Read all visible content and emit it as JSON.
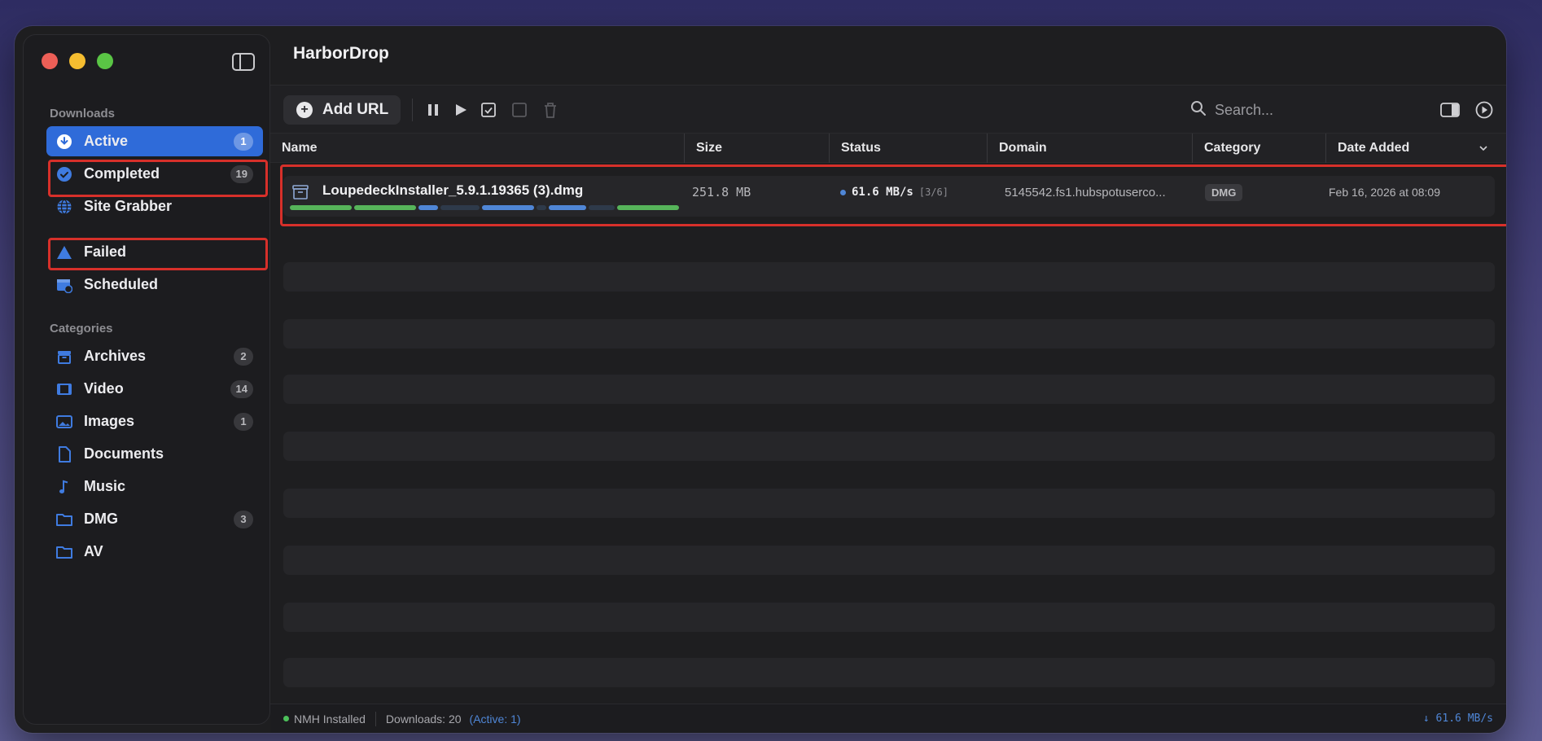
{
  "app": {
    "title": "HarborDrop"
  },
  "sidebar": {
    "downloads_title": "Downloads",
    "categories_title": "Categories",
    "downloads": [
      {
        "label": "Active",
        "badge": "1",
        "icon": "download-circle-icon"
      },
      {
        "label": "Completed",
        "badge": "19",
        "icon": "checkmark-circle-icon"
      },
      {
        "label": "Site Grabber",
        "badge": "",
        "icon": "globe-icon"
      },
      {
        "label": "Failed",
        "badge": "",
        "icon": "warning-triangle-icon"
      },
      {
        "label": "Scheduled",
        "badge": "",
        "icon": "calendar-clock-icon"
      }
    ],
    "categories": [
      {
        "label": "Archives",
        "badge": "2",
        "icon": "archive-box-icon"
      },
      {
        "label": "Video",
        "badge": "14",
        "icon": "film-icon"
      },
      {
        "label": "Images",
        "badge": "1",
        "icon": "photo-icon"
      },
      {
        "label": "Documents",
        "badge": "",
        "icon": "document-icon"
      },
      {
        "label": "Music",
        "badge": "",
        "icon": "music-note-icon"
      },
      {
        "label": "DMG",
        "badge": "3",
        "icon": "folder-icon"
      },
      {
        "label": "AV",
        "badge": "",
        "icon": "folder-icon"
      }
    ]
  },
  "toolbar": {
    "add_url_label": "Add URL",
    "search_placeholder": "Search..."
  },
  "table": {
    "columns": [
      "Name",
      "Size",
      "Status",
      "Domain",
      "Category",
      "Date Added"
    ],
    "rows": [
      {
        "name": "LoupedeckInstaller_5.9.1.19365 (3).dmg",
        "size": "251.8 MB",
        "speed": "61.6 MB/s",
        "segments": "[3/6]",
        "domain": "5145542.fs1.hubspotuserco...",
        "category": "DMG",
        "date_added": "Feb 16, 2026 at 08:09"
      }
    ]
  },
  "status_bar": {
    "nmh": "NMH Installed",
    "downloads": "Downloads: 20",
    "active": "(Active: 1)",
    "speed": "↓ 61.6 MB/s"
  },
  "colors": {
    "accent": "#2f6bd9",
    "highlight": "#d7302a",
    "segment_green": "#56b45a",
    "segment_blue": "#4f86d6",
    "status_green": "#4cc05a"
  }
}
